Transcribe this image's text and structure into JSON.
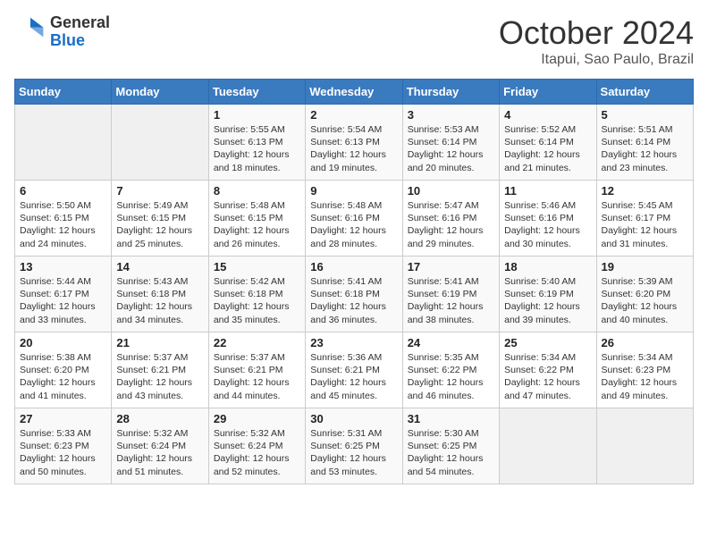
{
  "header": {
    "logo_general": "General",
    "logo_blue": "Blue",
    "month_title": "October 2024",
    "location": "Itapui, Sao Paulo, Brazil"
  },
  "weekdays": [
    "Sunday",
    "Monday",
    "Tuesday",
    "Wednesday",
    "Thursday",
    "Friday",
    "Saturday"
  ],
  "weeks": [
    [
      {
        "day": "",
        "info": ""
      },
      {
        "day": "",
        "info": ""
      },
      {
        "day": "1",
        "info": "Sunrise: 5:55 AM\nSunset: 6:13 PM\nDaylight: 12 hours and 18 minutes."
      },
      {
        "day": "2",
        "info": "Sunrise: 5:54 AM\nSunset: 6:13 PM\nDaylight: 12 hours and 19 minutes."
      },
      {
        "day": "3",
        "info": "Sunrise: 5:53 AM\nSunset: 6:14 PM\nDaylight: 12 hours and 20 minutes."
      },
      {
        "day": "4",
        "info": "Sunrise: 5:52 AM\nSunset: 6:14 PM\nDaylight: 12 hours and 21 minutes."
      },
      {
        "day": "5",
        "info": "Sunrise: 5:51 AM\nSunset: 6:14 PM\nDaylight: 12 hours and 23 minutes."
      }
    ],
    [
      {
        "day": "6",
        "info": "Sunrise: 5:50 AM\nSunset: 6:15 PM\nDaylight: 12 hours and 24 minutes."
      },
      {
        "day": "7",
        "info": "Sunrise: 5:49 AM\nSunset: 6:15 PM\nDaylight: 12 hours and 25 minutes."
      },
      {
        "day": "8",
        "info": "Sunrise: 5:48 AM\nSunset: 6:15 PM\nDaylight: 12 hours and 26 minutes."
      },
      {
        "day": "9",
        "info": "Sunrise: 5:48 AM\nSunset: 6:16 PM\nDaylight: 12 hours and 28 minutes."
      },
      {
        "day": "10",
        "info": "Sunrise: 5:47 AM\nSunset: 6:16 PM\nDaylight: 12 hours and 29 minutes."
      },
      {
        "day": "11",
        "info": "Sunrise: 5:46 AM\nSunset: 6:16 PM\nDaylight: 12 hours and 30 minutes."
      },
      {
        "day": "12",
        "info": "Sunrise: 5:45 AM\nSunset: 6:17 PM\nDaylight: 12 hours and 31 minutes."
      }
    ],
    [
      {
        "day": "13",
        "info": "Sunrise: 5:44 AM\nSunset: 6:17 PM\nDaylight: 12 hours and 33 minutes."
      },
      {
        "day": "14",
        "info": "Sunrise: 5:43 AM\nSunset: 6:18 PM\nDaylight: 12 hours and 34 minutes."
      },
      {
        "day": "15",
        "info": "Sunrise: 5:42 AM\nSunset: 6:18 PM\nDaylight: 12 hours and 35 minutes."
      },
      {
        "day": "16",
        "info": "Sunrise: 5:41 AM\nSunset: 6:18 PM\nDaylight: 12 hours and 36 minutes."
      },
      {
        "day": "17",
        "info": "Sunrise: 5:41 AM\nSunset: 6:19 PM\nDaylight: 12 hours and 38 minutes."
      },
      {
        "day": "18",
        "info": "Sunrise: 5:40 AM\nSunset: 6:19 PM\nDaylight: 12 hours and 39 minutes."
      },
      {
        "day": "19",
        "info": "Sunrise: 5:39 AM\nSunset: 6:20 PM\nDaylight: 12 hours and 40 minutes."
      }
    ],
    [
      {
        "day": "20",
        "info": "Sunrise: 5:38 AM\nSunset: 6:20 PM\nDaylight: 12 hours and 41 minutes."
      },
      {
        "day": "21",
        "info": "Sunrise: 5:37 AM\nSunset: 6:21 PM\nDaylight: 12 hours and 43 minutes."
      },
      {
        "day": "22",
        "info": "Sunrise: 5:37 AM\nSunset: 6:21 PM\nDaylight: 12 hours and 44 minutes."
      },
      {
        "day": "23",
        "info": "Sunrise: 5:36 AM\nSunset: 6:21 PM\nDaylight: 12 hours and 45 minutes."
      },
      {
        "day": "24",
        "info": "Sunrise: 5:35 AM\nSunset: 6:22 PM\nDaylight: 12 hours and 46 minutes."
      },
      {
        "day": "25",
        "info": "Sunrise: 5:34 AM\nSunset: 6:22 PM\nDaylight: 12 hours and 47 minutes."
      },
      {
        "day": "26",
        "info": "Sunrise: 5:34 AM\nSunset: 6:23 PM\nDaylight: 12 hours and 49 minutes."
      }
    ],
    [
      {
        "day": "27",
        "info": "Sunrise: 5:33 AM\nSunset: 6:23 PM\nDaylight: 12 hours and 50 minutes."
      },
      {
        "day": "28",
        "info": "Sunrise: 5:32 AM\nSunset: 6:24 PM\nDaylight: 12 hours and 51 minutes."
      },
      {
        "day": "29",
        "info": "Sunrise: 5:32 AM\nSunset: 6:24 PM\nDaylight: 12 hours and 52 minutes."
      },
      {
        "day": "30",
        "info": "Sunrise: 5:31 AM\nSunset: 6:25 PM\nDaylight: 12 hours and 53 minutes."
      },
      {
        "day": "31",
        "info": "Sunrise: 5:30 AM\nSunset: 6:25 PM\nDaylight: 12 hours and 54 minutes."
      },
      {
        "day": "",
        "info": ""
      },
      {
        "day": "",
        "info": ""
      }
    ]
  ]
}
